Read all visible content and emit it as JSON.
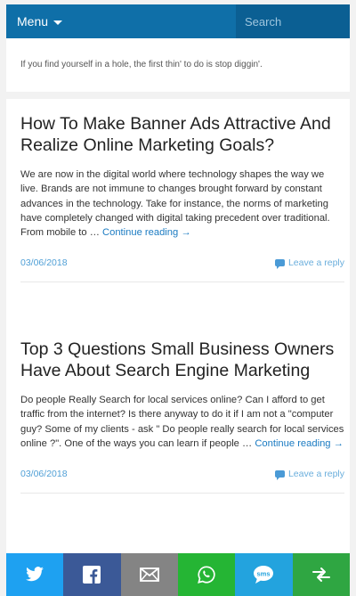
{
  "header": {
    "menu_label": "Menu",
    "search_placeholder": "Search"
  },
  "quote": "If you find yourself in a hole, the first thin' to do is stop diggin'.",
  "posts": [
    {
      "title": "How To Make Banner Ads Attractive And Realize Online Marketing Goals?",
      "excerpt": "We are now in the digital world where technology shapes the way we live. Brands are not immune to changes brought forward by constant advances in the technology. Take for instance, the norms of marketing have completely changed with digital taking precedent over traditional. From mobile to …",
      "continue_label": "Continue reading →",
      "date": "03/06/2018",
      "reply_label": "Leave a reply"
    },
    {
      "title": "Top 3 Questions Small Business Owners Have About Search Engine Marketing",
      "excerpt": "Do people Really Search for local services online? Can I afford to get traffic from the internet? Is there anyway to do it if I am not a \"computer guy? Some of my clients - ask \" Do people really search for local services online ?\". One of the ways you can learn if people …",
      "continue_label": "Continue reading →",
      "date": "03/06/2018",
      "reply_label": "Leave a reply"
    }
  ],
  "share_bar": [
    {
      "icon": "twitter-icon",
      "color": "#1ea1f1"
    },
    {
      "icon": "facebook-icon",
      "color": "#3b5997"
    },
    {
      "icon": "email-icon",
      "color": "#848484"
    },
    {
      "icon": "whatsapp-icon",
      "color": "#25b534"
    },
    {
      "icon": "sms-icon",
      "color": "#23a3de"
    },
    {
      "icon": "share-icon",
      "color": "#2fa642"
    }
  ]
}
